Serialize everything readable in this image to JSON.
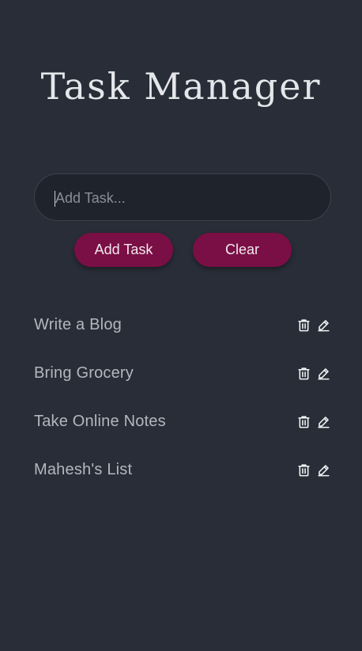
{
  "app": {
    "title": "Task Manager"
  },
  "input": {
    "placeholder": "Add Task...",
    "value": ""
  },
  "buttons": {
    "add_label": "Add Task",
    "clear_label": "Clear"
  },
  "tasks": [
    {
      "text": "Write a Blog",
      "delete_icon": "trash-icon",
      "edit_icon": "pencil-icon"
    },
    {
      "text": "Bring Grocery",
      "delete_icon": "trash-icon",
      "edit_icon": "pencil-icon"
    },
    {
      "text": "Take Online Notes",
      "delete_icon": "trash-icon",
      "edit_icon": "pencil-icon"
    },
    {
      "text": "Mahesh's List",
      "delete_icon": "trash-icon",
      "edit_icon": "pencil-icon"
    }
  ],
  "colors": {
    "background": "#282d37",
    "accent": "#7a0f45",
    "input_background": "#1f232c",
    "task_text": "#b4b7bd"
  }
}
